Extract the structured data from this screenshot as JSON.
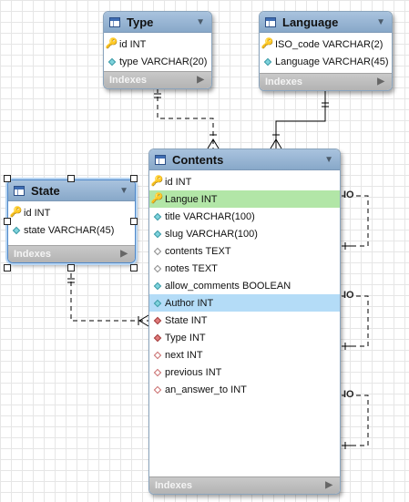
{
  "diagram": {
    "tables": {
      "type": {
        "title": "Type",
        "columns": [
          {
            "name": "id INT",
            "icon": "primary-key-icon"
          },
          {
            "name": "type VARCHAR(20)",
            "icon": "column-diamond-icon"
          }
        ],
        "indexes_label": "Indexes"
      },
      "language": {
        "title": "Language",
        "columns": [
          {
            "name": "ISO_code VARCHAR(2)",
            "icon": "primary-key-icon"
          },
          {
            "name": "Language VARCHAR(45)",
            "icon": "column-diamond-icon"
          }
        ],
        "indexes_label": "Indexes"
      },
      "state": {
        "title": "State",
        "columns": [
          {
            "name": "id INT",
            "icon": "primary-key-icon"
          },
          {
            "name": "state VARCHAR(45)",
            "icon": "column-diamond-icon"
          }
        ],
        "indexes_label": "Indexes"
      },
      "contents": {
        "title": "Contents",
        "columns": [
          {
            "name": "id INT",
            "icon": "primary-key-icon"
          },
          {
            "name": "Langue INT",
            "icon": "primary-key-icon"
          },
          {
            "name": "title VARCHAR(100)",
            "icon": "column-diamond-icon"
          },
          {
            "name": "slug VARCHAR(100)",
            "icon": "column-diamond-icon"
          },
          {
            "name": "contents TEXT",
            "icon": "nullable-column-icon"
          },
          {
            "name": "notes TEXT",
            "icon": "nullable-column-icon"
          },
          {
            "name": "allow_comments BOOLEAN",
            "icon": "column-diamond-icon"
          },
          {
            "name": "Author INT",
            "icon": "column-diamond-icon"
          },
          {
            "name": "State INT",
            "icon": "foreign-key-icon"
          },
          {
            "name": "Type INT",
            "icon": "foreign-key-icon"
          },
          {
            "name": "next INT",
            "icon": "nullable-foreign-key-icon"
          },
          {
            "name": "previous INT",
            "icon": "nullable-foreign-key-icon"
          },
          {
            "name": "an_answer_to INT",
            "icon": "nullable-foreign-key-icon"
          }
        ],
        "indexes_label": "Indexes"
      }
    },
    "self_relationship_label": "IO",
    "colors": {
      "header": "#99b8d8",
      "highlight_green": "#b2e6a7",
      "highlight_blue": "#b4dcf7",
      "indexes_bar": "#bdbdbd"
    }
  }
}
